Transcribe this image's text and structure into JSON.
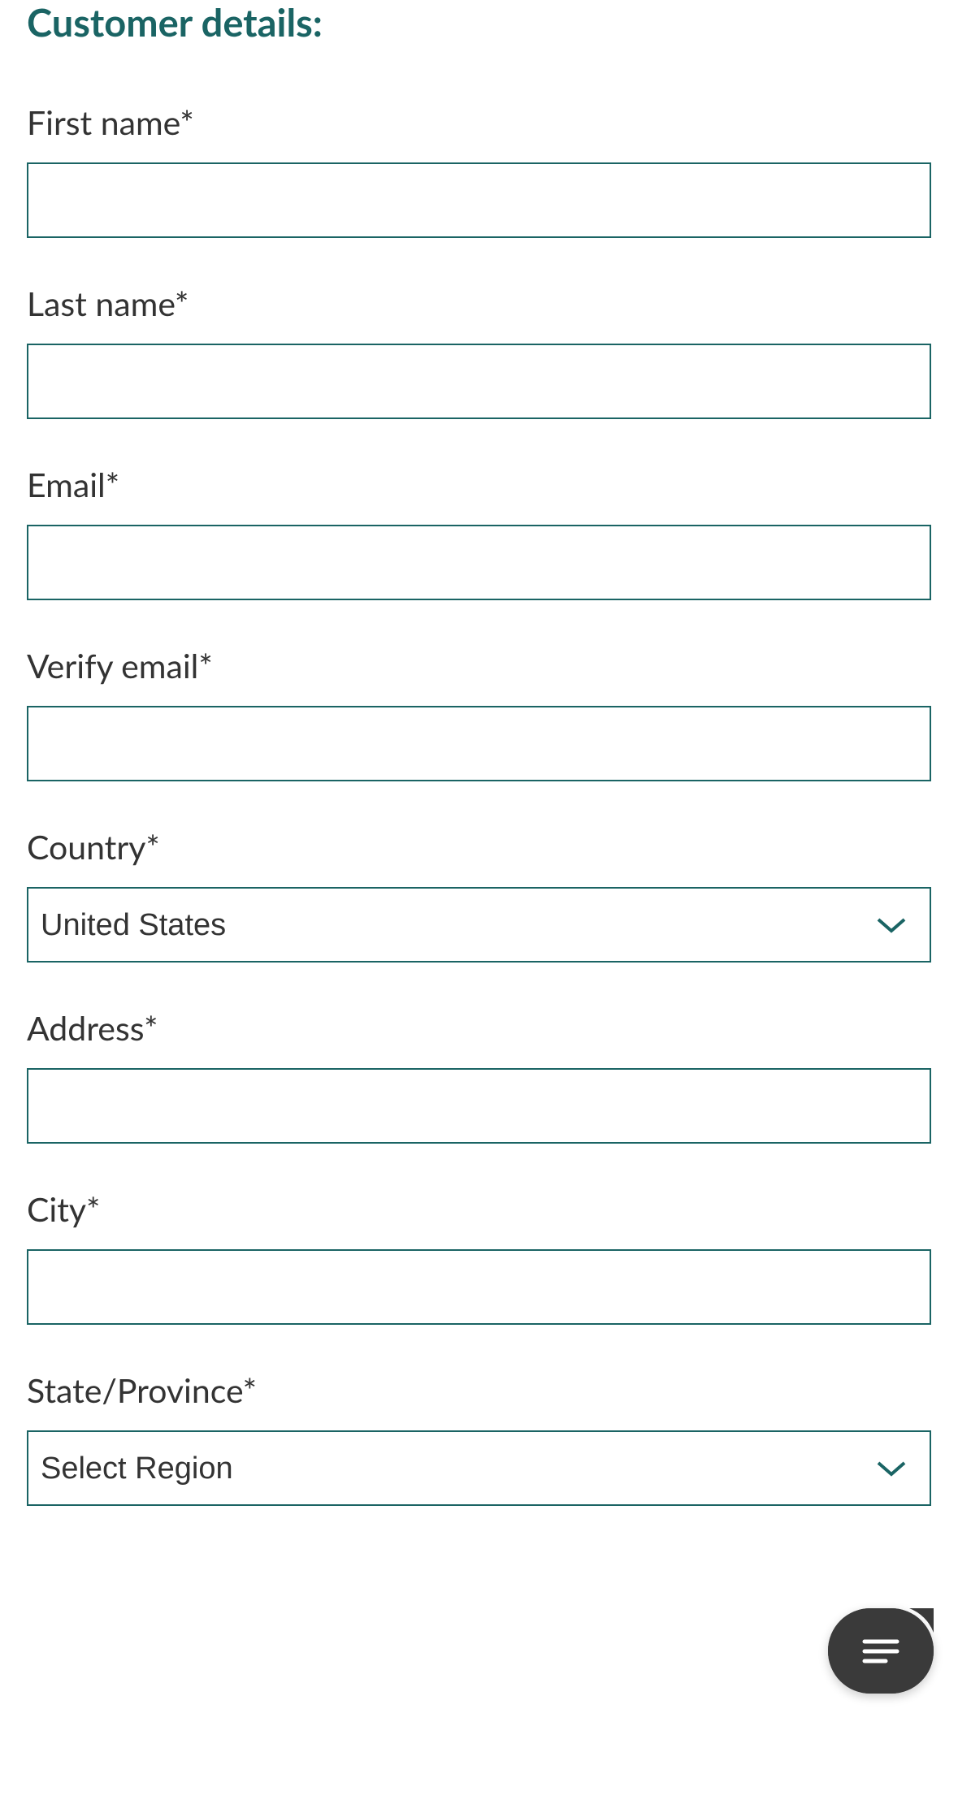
{
  "section_title": "Customer details:",
  "fields": {
    "first_name": {
      "label": "First name*",
      "value": ""
    },
    "last_name": {
      "label": "Last name*",
      "value": ""
    },
    "email": {
      "label": "Email*",
      "value": ""
    },
    "verify_email": {
      "label": "Verify email*",
      "value": ""
    },
    "country": {
      "label": "Country*",
      "selected": "United States"
    },
    "address": {
      "label": "Address*",
      "value": ""
    },
    "city": {
      "label": "City*",
      "value": ""
    },
    "state": {
      "label": "State/Province*",
      "selected": "Select Region"
    }
  },
  "colors": {
    "teal": "#1a6464",
    "text": "#333333"
  }
}
